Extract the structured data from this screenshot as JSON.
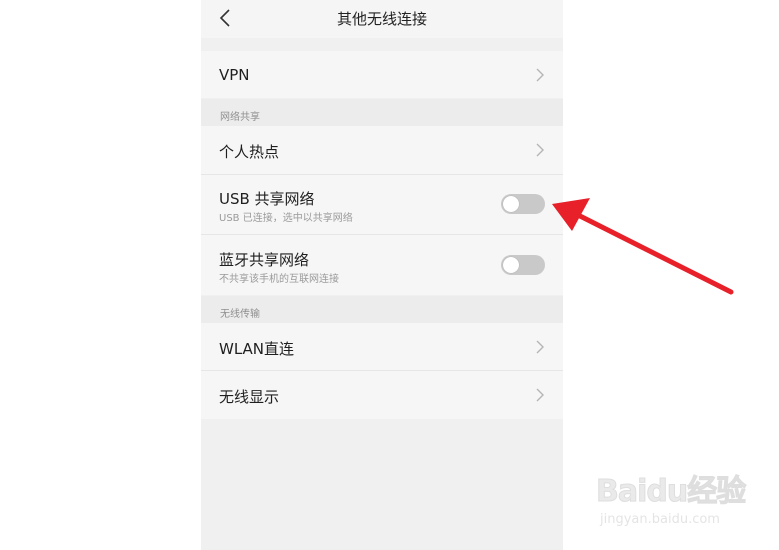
{
  "header": {
    "title": "其他无线连接"
  },
  "rows": {
    "vpn": {
      "label": "VPN"
    },
    "hotspot": {
      "label": "个人热点"
    },
    "usb_tether": {
      "label": "USB 共享网络",
      "subtitle": "USB 已连接，选中以共享网络",
      "enabled": false
    },
    "bt_tether": {
      "label": "蓝牙共享网络",
      "subtitle": "不共享该手机的互联网连接",
      "enabled": false
    },
    "wlan_direct": {
      "label": "WLAN直连"
    },
    "wireless_display": {
      "label": "无线显示"
    }
  },
  "sections": {
    "network_sharing": "网络共享",
    "wireless_transfer": "无线传输"
  },
  "annotation": {
    "arrow_color": "#e8202a"
  },
  "watermark": {
    "brand": "Baidu经验",
    "url": "jingyan.baidu.com"
  },
  "icons": [
    "back-icon",
    "chevron-right-icon"
  ]
}
